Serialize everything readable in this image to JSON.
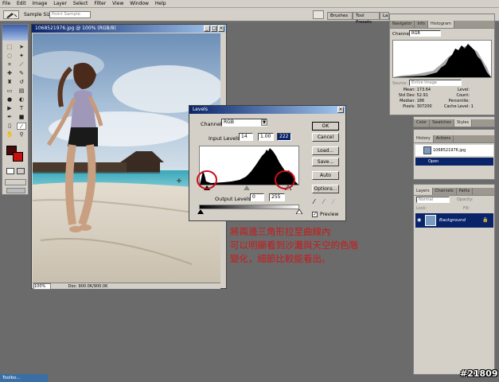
{
  "menu": [
    "File",
    "Edit",
    "Image",
    "Layer",
    "Select",
    "Filter",
    "View",
    "Window",
    "Help"
  ],
  "options_bar": {
    "sample_size_label": "Sample Size:",
    "sample_size_value": "Point Sample",
    "well_tabs": [
      "Brushes",
      "Tool Presets",
      "La"
    ]
  },
  "document": {
    "title": "1068521976.jpg @ 100% (RGB/8)",
    "zoom": "100%",
    "doc_size": "Doc: 900.0K/900.0K"
  },
  "levels": {
    "title": "Levels",
    "channel_label": "Channel:",
    "channel_value": "RGB",
    "input_levels_label": "Input Levels:",
    "input_black": "14",
    "input_gamma": "1.00",
    "input_white": "222",
    "output_levels_label": "Output Levels:",
    "output_black": "0",
    "output_white": "255",
    "buttons": [
      "OK",
      "Cancel",
      "Load...",
      "Save...",
      "Auto",
      "Options..."
    ],
    "preview_label": "Preview",
    "preview_checked": true,
    "highlight_color": "#c8101a"
  },
  "histogram_panel": {
    "tabs": [
      "Navigator",
      "Info",
      "Histogram"
    ],
    "channel_label": "Channel:",
    "channel_value": "RGB",
    "source_label": "Source:",
    "source_value": "Entire Image",
    "stats_left": [
      {
        "label": "Mean:",
        "value": "173.64"
      },
      {
        "label": "Std Dev:",
        "value": "52.91"
      },
      {
        "label": "Median:",
        "value": "186"
      },
      {
        "label": "Pixels:",
        "value": "307200"
      }
    ],
    "stats_right": [
      {
        "label": "Level:",
        "value": ""
      },
      {
        "label": "Count:",
        "value": ""
      },
      {
        "label": "Percentile:",
        "value": ""
      },
      {
        "label": "Cache Level:",
        "value": "1"
      }
    ]
  },
  "color_panel": {
    "tabs": [
      "Color",
      "Swatches",
      "Styles"
    ]
  },
  "history_panel": {
    "tabs": [
      "History",
      "Actions"
    ],
    "snapshot": "1068521976.jpg",
    "active_state": "Open"
  },
  "layers_panel": {
    "tabs": [
      "Layers",
      "Channels",
      "Paths"
    ],
    "blend_mode": "Normal",
    "opacity_label": "Opacity:",
    "fill_label": "Fill:",
    "lock_label": "Lock:",
    "layer_name": "Background"
  },
  "annotation": {
    "lines": [
      "將兩邊三角形拉至曲線內",
      "可以明顯看到沙灘與天空的色階",
      "變化，細節比較能看出。"
    ],
    "color": "#c81a1a"
  },
  "taskbar": {
    "label": "Toolbo..."
  },
  "stamp": "#21809",
  "icons": [
    "eyedropper-icon",
    "lock-icon",
    "eye-icon",
    "brush-icon",
    "close-icon",
    "minimize-icon",
    "maximize-icon"
  ]
}
